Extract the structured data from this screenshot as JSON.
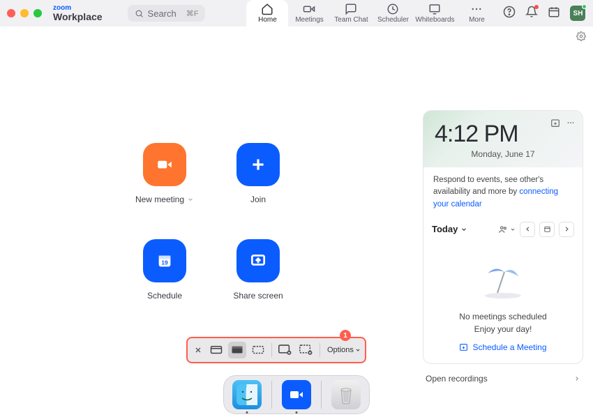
{
  "branding": {
    "zoom": "zoom",
    "workplace": "Workplace"
  },
  "search": {
    "placeholder": "Search",
    "shortcut": "⌘F"
  },
  "tabs": {
    "home": "Home",
    "meetings": "Meetings",
    "team_chat": "Team Chat",
    "scheduler": "Scheduler",
    "whiteboards": "Whiteboards",
    "more": "More"
  },
  "avatar_initials": "SH",
  "tiles": {
    "new_meeting": "New meeting",
    "join": "Join",
    "schedule": "Schedule",
    "schedule_day": "19",
    "share_screen": "Share screen"
  },
  "clock": {
    "time": "4:12 PM",
    "date": "Monday, June 17"
  },
  "calendar_prompt": {
    "text_a": "Respond to events, see other's availability and more by ",
    "link": "connecting your calendar"
  },
  "toolbar": {
    "today": "Today"
  },
  "empty_state": {
    "line1": "No meetings scheduled",
    "line2": "Enjoy your day!",
    "schedule_link": "Schedule a Meeting"
  },
  "recordings_row": "Open recordings",
  "screenshot_toolbar": {
    "badge": "1",
    "options": "Options"
  },
  "dock": {
    "finder": "Finder",
    "zoom": "Zoom",
    "trash": "Trash"
  }
}
